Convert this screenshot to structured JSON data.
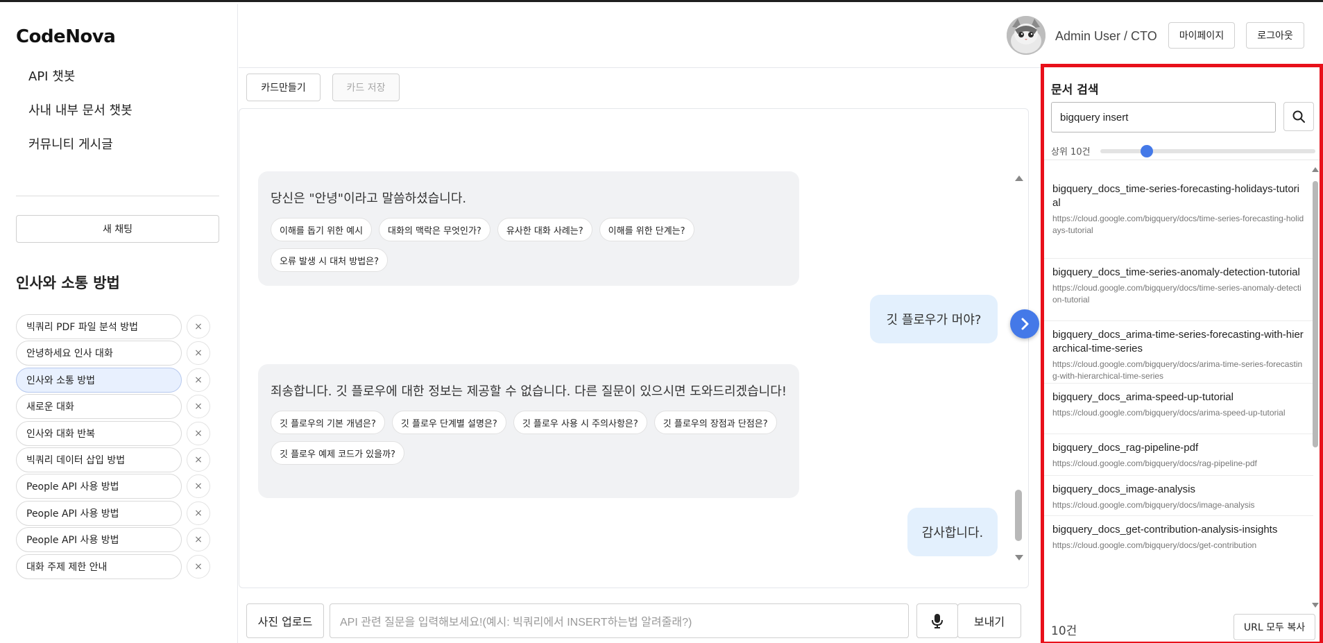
{
  "sidebar": {
    "brand": "CodeNova",
    "nav": [
      {
        "label": "API 챗봇"
      },
      {
        "label": "사내 내부 문서 챗봇"
      },
      {
        "label": "커뮤니티 게시글"
      }
    ],
    "new_chat_label": "새 채팅",
    "section_title": "인사와 소통 방법",
    "chats": [
      {
        "label": "빅쿼리 PDF 파일 분석 방법",
        "active": false
      },
      {
        "label": "안녕하세요 인사 대화",
        "active": false
      },
      {
        "label": "인사와 소통 방법",
        "active": true
      },
      {
        "label": "새로운 대화",
        "active": false
      },
      {
        "label": "인사와 대화 반복",
        "active": false
      },
      {
        "label": "빅쿼리 데이터 삽입 방법",
        "active": false
      },
      {
        "label": "People API 사용 방법",
        "active": false
      },
      {
        "label": "People API 사용 방법",
        "active": false
      },
      {
        "label": "People API 사용 방법",
        "active": false
      },
      {
        "label": "대화 주제 제한 안내",
        "active": false
      }
    ],
    "delete_glyph": "×"
  },
  "header": {
    "user": "Admin User / CTO",
    "mypage_label": "마이페이지",
    "logout_label": "로그아웃"
  },
  "toolbar": {
    "make_card_label": "카드만들기",
    "save_card_label": "카드 저장"
  },
  "chat": {
    "messages": [
      {
        "role": "bot",
        "text": "당신은 \"안녕\"이라고 말씀하셨습니다.",
        "chips": [
          "이해를 돕기 위한 예시",
          "대화의 맥락은 무엇인가?",
          "유사한 대화 사례는?",
          "이해를 위한 단계는?",
          "오류 발생 시 대처 방법은?"
        ]
      },
      {
        "role": "user",
        "text": "깃 플로우가 머야?"
      },
      {
        "role": "bot",
        "text": "죄송합니다. 깃 플로우에 대한 정보는 제공할 수 없습니다. 다른 질문이 있으시면 도와드리겠습니다!",
        "chips": [
          "깃 플로우의 기본 개념은?",
          "깃 플로우 단계별 설명은?",
          "깃 플로우 사용 시 주의사항은?",
          "깃 플로우의 장점과 단점은?",
          "깃 플로우 예제 코드가 있을까?"
        ]
      },
      {
        "role": "user",
        "text": "감사합니다."
      }
    ]
  },
  "input": {
    "upload_label": "사진 업로드",
    "placeholder": "API 관련 질문을 입력해보세요!(예시: 빅쿼리에서 INSERT하는법 알려줄래?)",
    "send_label": "보내기"
  },
  "doc_panel": {
    "title": "문서 검색",
    "query": "bigquery insert",
    "topk_label": "상위 10건",
    "topk_value": 10,
    "results": [
      {
        "title": "bigquery_docs_time-series-forecasting-holidays-tutorial",
        "url": "https://cloud.google.com/bigquery/docs/time-series-forecasting-holidays-tutorial"
      },
      {
        "title": "bigquery_docs_time-series-anomaly-detection-tutorial",
        "url": "https://cloud.google.com/bigquery/docs/time-series-anomaly-detection-tutorial"
      },
      {
        "title": "bigquery_docs_arima-time-series-forecasting-with-hierarchical-time-series",
        "url": "https://cloud.google.com/bigquery/docs/arima-time-series-forecasting-with-hierarchical-time-series"
      },
      {
        "title": "bigquery_docs_arima-speed-up-tutorial",
        "url": "https://cloud.google.com/bigquery/docs/arima-speed-up-tutorial"
      },
      {
        "title": "bigquery_docs_rag-pipeline-pdf",
        "url": "https://cloud.google.com/bigquery/docs/rag-pipeline-pdf"
      },
      {
        "title": "bigquery_docs_image-analysis",
        "url": "https://cloud.google.com/bigquery/docs/image-analysis"
      },
      {
        "title": "bigquery_docs_get-contribution-analysis-insights",
        "url": "https://cloud.google.com/bigquery/docs/get-contribution"
      }
    ],
    "count_label": "10건",
    "copy_label": "URL 모두 복사"
  },
  "colors": {
    "accent": "#4479e8",
    "panel_border": "#e8101a",
    "user_bubble": "#e3f0fd",
    "bot_bubble": "#f1f2f4"
  },
  "icons": {
    "search": "search-icon",
    "mic": "microphone-icon",
    "toggle": "chevron-right-icon"
  }
}
